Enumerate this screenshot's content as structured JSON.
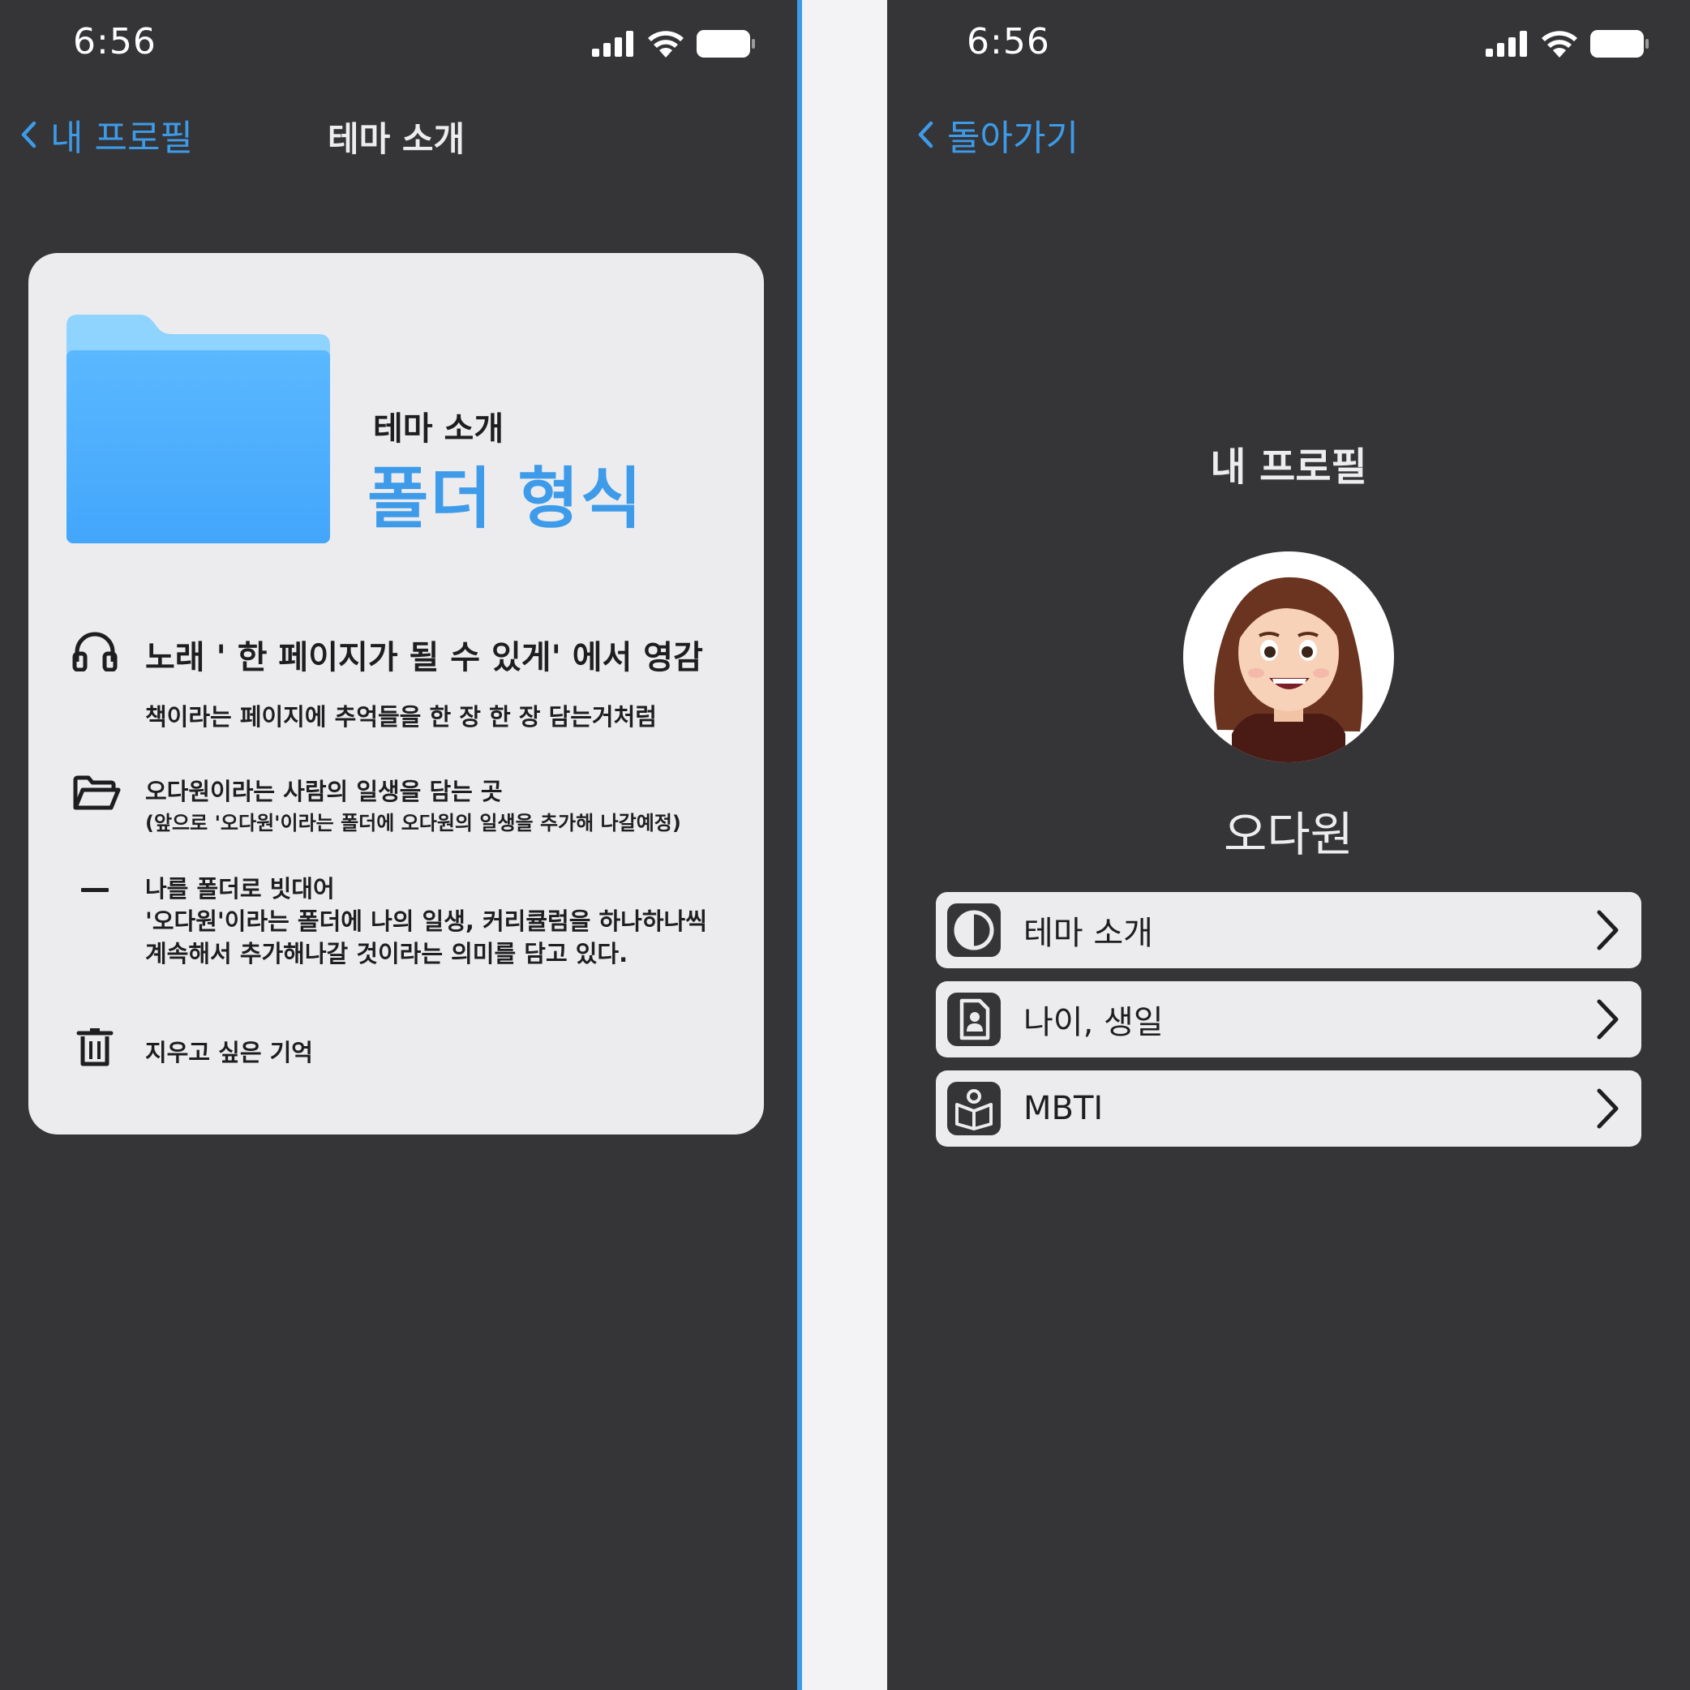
{
  "left": {
    "status": {
      "time": "6:56"
    },
    "nav": {
      "back_label": "내 프로필",
      "title": "테마 소개"
    },
    "card": {
      "hero_label": "테마 소개",
      "hero_title": "폴더 형식",
      "items": [
        {
          "icon": "headphones-icon",
          "title": "노래 ' 한 페이지가 될 수 있게' 에서 영감",
          "lines": [
            "책이라는 페이지에 추억들을 한 장 한 장 담는거처럼"
          ]
        },
        {
          "icon": "folder-open-icon",
          "title": "오다원이라는 사람의 일생을 담는 곳",
          "lines": [
            "(앞으로 '오다원'이라는 폴더에 오다원의 일생을 추가해 나갈예정)"
          ]
        },
        {
          "icon": "minus-icon",
          "title": "나를 폴더로 빗대어",
          "lines": [
            "'오다원'이라는 폴더에 나의 일생, 커리큘럼을 하나하나씩",
            "계속해서 추가해나갈 것이라는 의미를 담고 있다."
          ]
        },
        {
          "icon": "trash-icon",
          "title": "지우고 싶은 기억",
          "lines": []
        }
      ]
    }
  },
  "right": {
    "status": {
      "time": "6:56"
    },
    "nav": {
      "back_label": "돌아가기"
    },
    "profile_title": "내 프로필",
    "name": "오다원",
    "menu": [
      {
        "icon": "half-circle-icon",
        "label": "테마 소개"
      },
      {
        "icon": "id-card-icon",
        "label": "나이, 생일"
      },
      {
        "icon": "reading-person-icon",
        "label": "MBTI"
      }
    ]
  },
  "colors": {
    "background": "#353537",
    "accent": "#3d9be9",
    "card": "#ececee",
    "text_dark": "#1e1e20",
    "folder_top": "#8fd3ff",
    "folder_body": "#4aaafc"
  }
}
